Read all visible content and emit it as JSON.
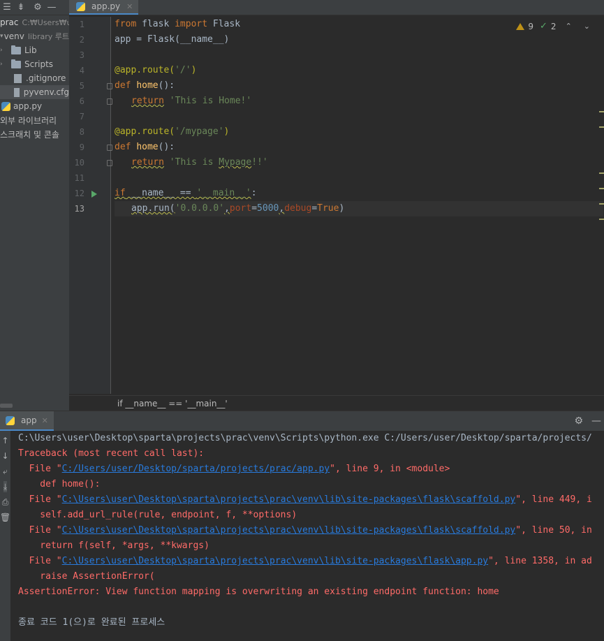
{
  "project": {
    "toolbar_icons": [
      "list-icon",
      "collapse-icon",
      "gear-icon",
      "minimize-icon"
    ],
    "root_name": "prac",
    "root_path": "C:₩Users₩us",
    "items": [
      {
        "label": "venv",
        "hint": "library 루트",
        "type": "folder",
        "expanded": true
      },
      {
        "label": "Lib",
        "type": "folder"
      },
      {
        "label": "Scripts",
        "type": "folder"
      },
      {
        "label": ".gitignore",
        "type": "file"
      },
      {
        "label": "pyvenv.cfg",
        "type": "file"
      },
      {
        "label": "app.py",
        "type": "python"
      },
      {
        "label": "외부 라이브러리",
        "type": "group"
      },
      {
        "label": "스크래치 및 콘솔",
        "type": "group"
      }
    ]
  },
  "editor": {
    "tab_label": "app.py",
    "warnings": "9",
    "checks": "2",
    "line_numbers": [
      "1",
      "2",
      "3",
      "4",
      "5",
      "6",
      "7",
      "8",
      "9",
      "10",
      "11",
      "12",
      "13"
    ],
    "breadcrumb": "if __name__ == '__main__'",
    "code": {
      "l1_kw1": "from",
      "l1_mid": " flask ",
      "l1_kw2": "import",
      "l1_end": " Flask",
      "l2": "app = Flask(__name__)",
      "l4_dec": "@app.route(",
      "l4_str": "'/'",
      "l4_close": ")",
      "l5_kw": "def ",
      "l5_fn": "home",
      "l5_end": "():",
      "l6_kw": "return",
      "l6_str": " 'This is Home!'",
      "l8_dec": "@app.route(",
      "l8_str": "'/mypage'",
      "l8_close": ")",
      "l9_kw": "def ",
      "l9_fn": "home",
      "l9_end": "():",
      "l10_kw": "return",
      "l10_str1": " 'This is ",
      "l10_str2": "Mypage",
      "l10_str3": "!!'",
      "l12_kw": "if",
      "l12_mid": " __name__ == ",
      "l12_str": "'__main__'",
      "l12_end": ":",
      "l13_a": "app.run(",
      "l13_s": "'0.0.0.0'",
      "l13_c1": ",",
      "l13_p1": "port",
      "l13_eq1": "=",
      "l13_n": "5000",
      "l13_c2": ",",
      "l13_p2": "debug",
      "l13_eq2": "=",
      "l13_t": "True",
      "l13_end": ")"
    }
  },
  "run": {
    "tab_label": "app",
    "lines": {
      "cmd": "C:\\Users\\user\\Desktop\\sparta\\projects\\prac\\venv\\Scripts\\python.exe C:/Users/user/Desktop/sparta/projects/",
      "tb": "Traceback (most recent call last):",
      "f1_pre": "  File \"",
      "f1_link": "C:/Users/user/Desktop/sparta/projects/prac/app.py",
      "f1_post": "\", line 9, in <module>",
      "c1": "    def home():",
      "f2_pre": "  File \"",
      "f2_link": "C:\\Users\\user\\Desktop\\sparta\\projects\\prac\\venv\\lib\\site-packages\\flask\\scaffold.py",
      "f2_post": "\", line 449, i",
      "c2": "    self.add_url_rule(rule, endpoint, f, **options)",
      "f3_pre": "  File \"",
      "f3_link": "C:\\Users\\user\\Desktop\\sparta\\projects\\prac\\venv\\lib\\site-packages\\flask\\scaffold.py",
      "f3_post": "\", line 50, in",
      "c3": "    return f(self, *args, **kwargs)",
      "f4_pre": "  File \"",
      "f4_link": "C:\\Users\\user\\Desktop\\sparta\\projects\\prac\\venv\\lib\\site-packages\\flask\\app.py",
      "f4_post": "\", line 1358, in ad",
      "c4": "    raise AssertionError(",
      "err": "AssertionError: View function mapping is overwriting an existing endpoint function: home",
      "exit": "종료 코드 1(으)로 완료된 프로세스"
    }
  },
  "colors": {
    "keyword": "#cc7832",
    "string": "#6a8759",
    "decorator": "#bbb529",
    "function": "#ffc66d",
    "error": "#ff6b68",
    "link": "#287bde"
  }
}
